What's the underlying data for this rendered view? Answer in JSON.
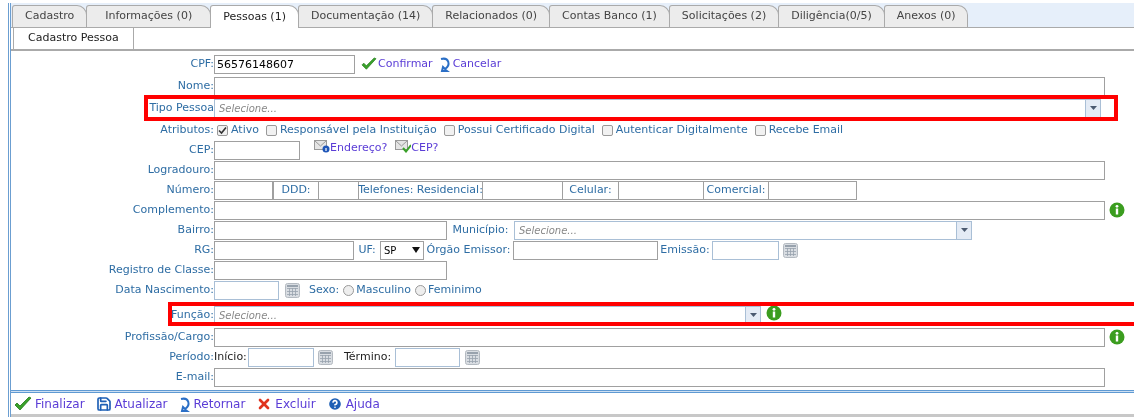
{
  "tabs": [
    {
      "label": "Cadastro",
      "selected": false
    },
    {
      "label": "Informações (0)",
      "selected": false
    },
    {
      "label": "Pessoas (1)",
      "selected": true
    },
    {
      "label": "Documentação (14)",
      "selected": false
    },
    {
      "label": "Relacionados (0)",
      "selected": false
    },
    {
      "label": "Contas Banco (1)",
      "selected": false
    },
    {
      "label": "Solicitações (2)",
      "selected": false
    },
    {
      "label": "Diligência(0/5)",
      "selected": false
    },
    {
      "label": "Anexos (0)",
      "selected": false
    }
  ],
  "subtabs": [
    {
      "label": "Cadastro Pessoa",
      "selected": true
    }
  ],
  "form": {
    "cpf": {
      "label": "CPF:",
      "value": "56576148607",
      "confirm": "Confirmar",
      "cancel": "Cancelar"
    },
    "nome": {
      "label": "Nome:"
    },
    "tipo_pessoa": {
      "label": "Tipo Pessoa",
      "placeholder": "Selecione...",
      "highlighted": true
    },
    "atributos": {
      "label": "Atributos:",
      "options": [
        {
          "label": "Ativo",
          "checked": true
        },
        {
          "label": "Responsável pela Instituição",
          "checked": false
        },
        {
          "label": "Possui Certificado Digital",
          "checked": false
        },
        {
          "label": "Autenticar Digitalmente",
          "checked": false
        },
        {
          "label": "Recebe Email",
          "checked": false
        }
      ]
    },
    "cep": {
      "label": "CEP:",
      "address_link": "Endereço?",
      "cep_link": "CEP?"
    },
    "logradouro": {
      "label": "Logradouro:"
    },
    "numero": {
      "label": "Número:",
      "ddd": "DDD:",
      "residencial": "Telefones: Residencial:",
      "celular": "Celular:",
      "comercial": "Comercial:"
    },
    "complemento": {
      "label": "Complemento:"
    },
    "bairro": {
      "label": "Bairro:",
      "municipio": "Município:",
      "municipio_placeholder": "Selecione..."
    },
    "rg": {
      "label": "RG:",
      "uf": "UF:",
      "uf_value": "SP",
      "orgao": "Órgão Emissor:",
      "emissao": "Emissão:"
    },
    "registro": {
      "label": "Registro de Classe:"
    },
    "nascimento": {
      "label": "Data Nascimento:",
      "sexo": "Sexo:",
      "options": [
        {
          "label": "Masculino",
          "selected": false
        },
        {
          "label": "Feminimo",
          "selected": false
        }
      ]
    },
    "funcao": {
      "label": "Função:",
      "placeholder": "Selecione...",
      "highlighted": true
    },
    "profissao": {
      "label": "Profissão/Cargo:"
    },
    "periodo": {
      "label": "Período:",
      "inicio": "Início:",
      "termino": "Término:"
    },
    "email": {
      "label": "E-mail:"
    }
  },
  "toolbar": [
    {
      "label": "Finalizar",
      "kind": "finish"
    },
    {
      "label": "Atualizar",
      "kind": "save"
    },
    {
      "label": "Retornar",
      "kind": "back"
    },
    {
      "label": "Excluir",
      "kind": "delete"
    },
    {
      "label": "Ajuda",
      "kind": "help"
    }
  ]
}
